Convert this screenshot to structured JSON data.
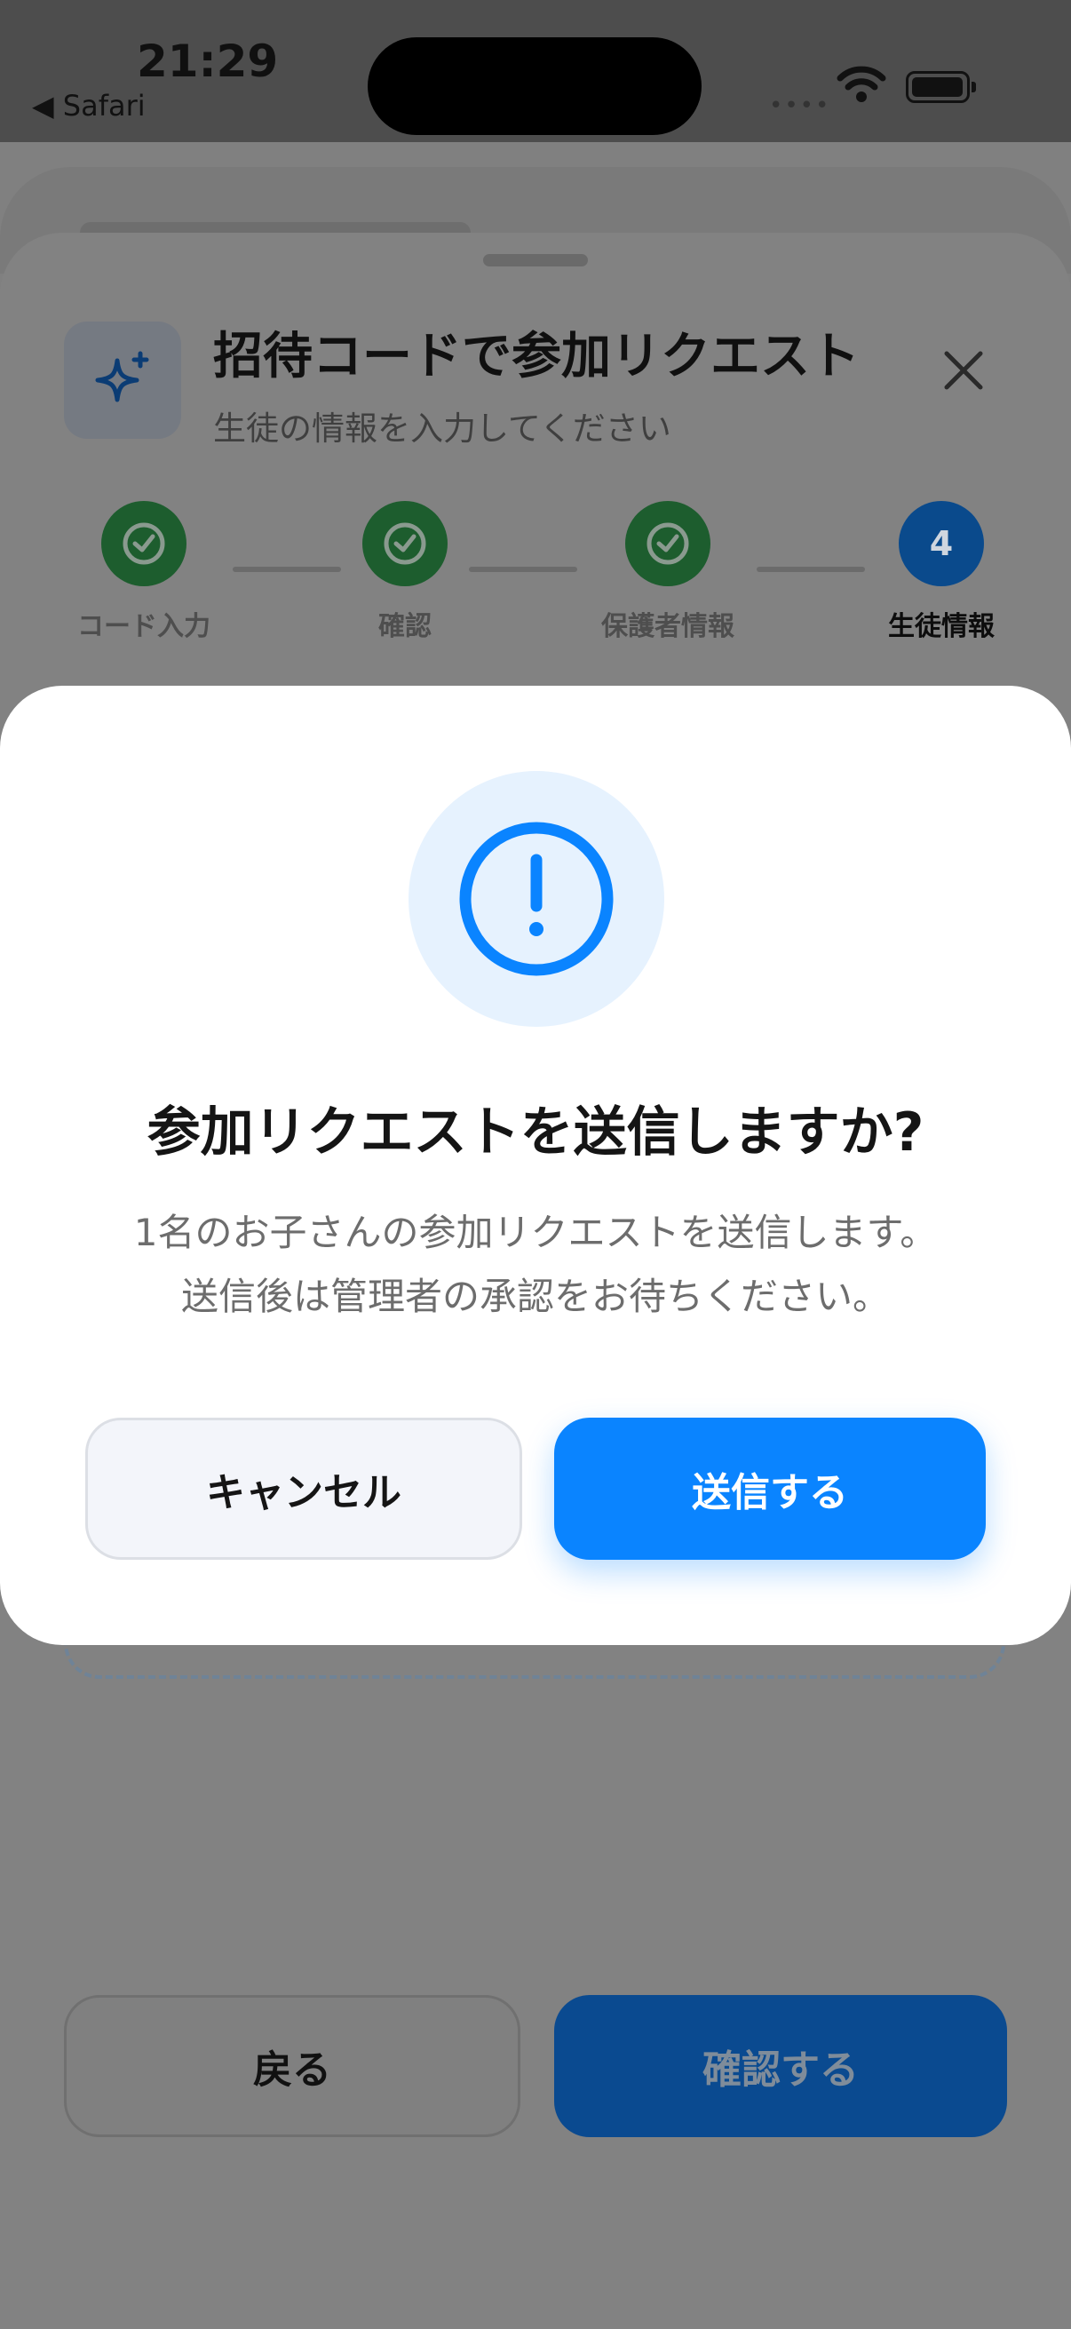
{
  "status_bar": {
    "time": "21:29",
    "back_label": "◀ Safari",
    "signal": "••••"
  },
  "sheet": {
    "title": "招待コードで参加リクエスト",
    "subtitle": "生徒の情報を入力してください",
    "steps": [
      {
        "label": "コード入力",
        "state": "done"
      },
      {
        "label": "確認",
        "state": "done"
      },
      {
        "label": "保護者情報",
        "state": "done"
      },
      {
        "label": "生徒情報",
        "number": "4",
        "state": "current"
      }
    ],
    "back_button": "戻る",
    "confirm_button": "確認する"
  },
  "dialog": {
    "icon": "alert-circle-icon",
    "title": "参加リクエストを送信しますか?",
    "message_line1": "1名のお子さんの参加リクエストを送信します。",
    "message_line2": "送信後は管理者の承認をお待ちください。",
    "cancel_button": "キャンセル",
    "send_button": "送信する"
  },
  "colors": {
    "accent": "#0a84ff",
    "step_done": "#34c759",
    "overlay": "#808080",
    "icon_bg": "#e6f2fe"
  }
}
